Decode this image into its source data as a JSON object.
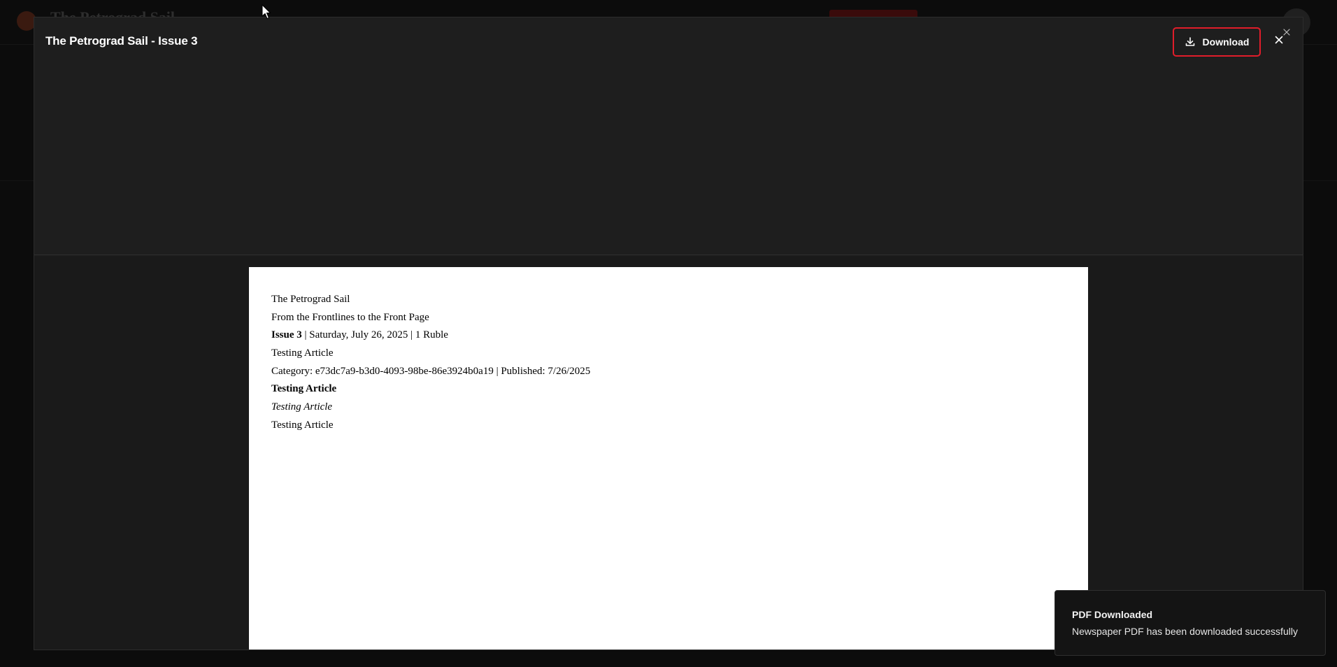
{
  "background": {
    "site_title": "The Petrograd Sail"
  },
  "modal": {
    "title": "The Petrograd Sail - Issue 3",
    "download_label": "Download",
    "download_icon": "download-icon",
    "close_icon": "close-icon",
    "accent_color": "#e11d2a"
  },
  "pdf": {
    "masthead": "The Petrograd Sail",
    "tagline": "From the Frontlines to the Front Page",
    "issue_label": "Issue 3",
    "issue_meta": " | Saturday, July 26, 2025 | 1 Ruble",
    "article_title": "Testing Article",
    "article_meta": "Category: e73dc7a9-b3d0-4093-98be-86e3924b0a19 | Published: 7/26/2025",
    "body_bold": "Testing Article",
    "body_italic": "Testing Article",
    "body_plain": "Testing Article"
  },
  "toast": {
    "title": "PDF Downloaded",
    "description": "Newspaper PDF has been downloaded successfully"
  }
}
